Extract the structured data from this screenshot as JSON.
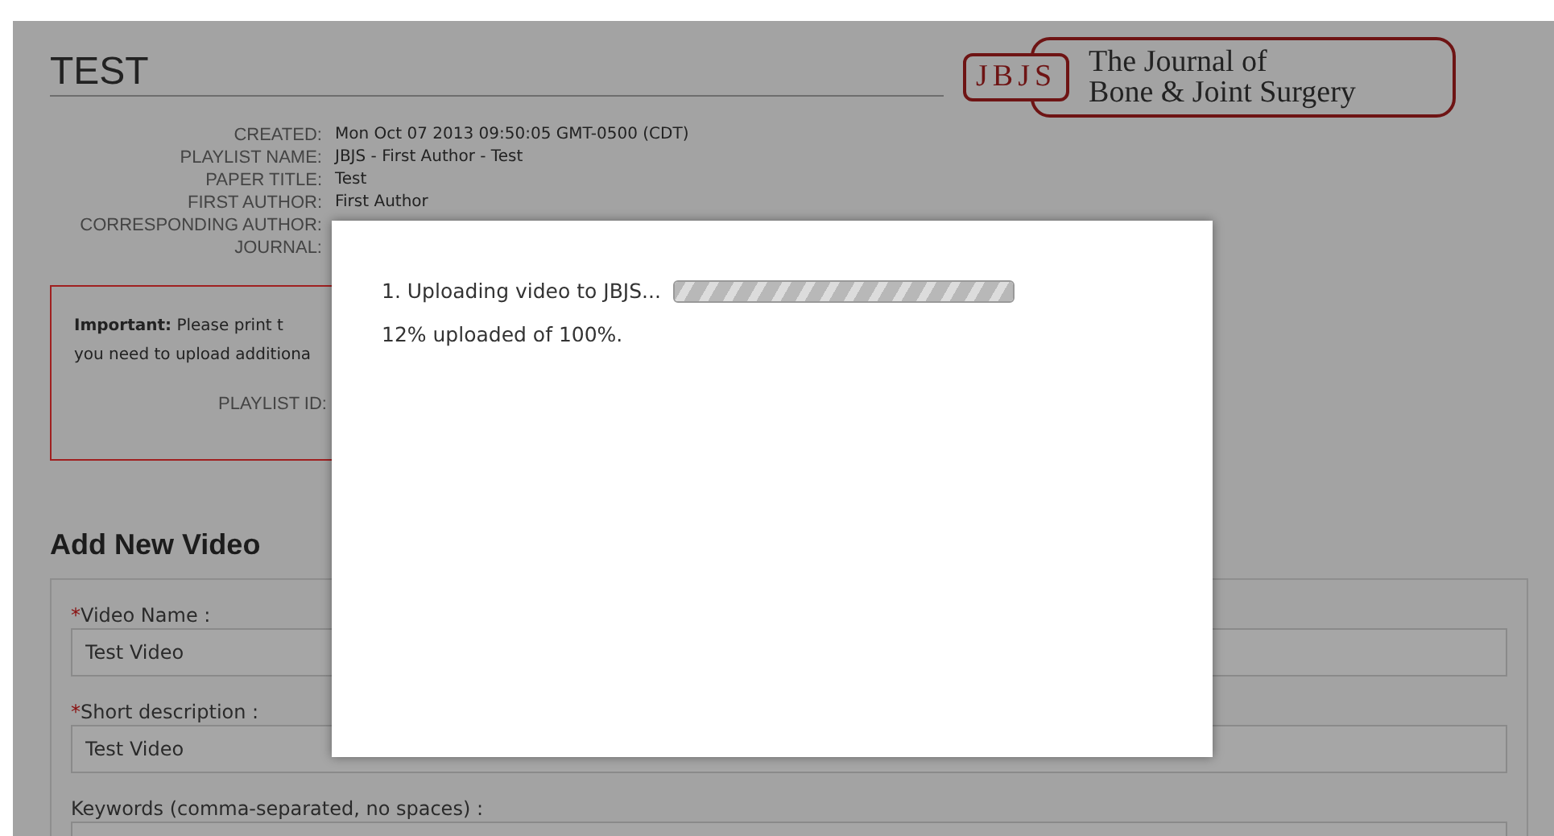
{
  "page": {
    "title": "TEST",
    "logo": {
      "mark": "JBJS",
      "line_1": "The Journal of",
      "line_2": "Bone & Joint Surgery"
    },
    "details": [
      {
        "label": "CREATED:",
        "value": "Mon Oct 07 2013 09:50:05 GMT-0500 (CDT)"
      },
      {
        "label": "PLAYLIST NAME:",
        "value": "JBJS - First Author - Test"
      },
      {
        "label": "PAPER TITLE:",
        "value": "Test"
      },
      {
        "label": "FIRST AUTHOR:",
        "value": "First Author"
      },
      {
        "label": "CORRESPONDING AUTHOR:"
      },
      {
        "label": "JOURNAL:"
      }
    ],
    "notice": {
      "text": "**Important:** Please print t",
      "text_2": "you need to upload additiona",
      "playlist_id_label": "PLAYLIST ID:"
    },
    "section_title": "Add New Video",
    "fields": [
      {
        "required_mark": "*",
        "label": "Video Name :",
        "value": "Test Video"
      },
      {
        "required_mark": "*",
        "label": "Short description :",
        "value": "Test Video"
      },
      {
        "label": "Keywords (comma-separated, no spaces) :"
      }
    ]
  },
  "modal": {
    "step": "1. Uploading video to JBJS...",
    "level": 1,
    "status": "12% uploaded of 100%."
  }
}
